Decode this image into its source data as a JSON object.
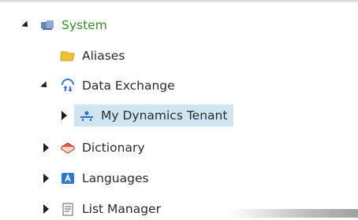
{
  "tree": {
    "nodes": [
      {
        "label": "System",
        "expanded": true,
        "icon": "system-icon"
      },
      {
        "label": "Aliases",
        "expanded": null,
        "icon": "folder-icon"
      },
      {
        "label": "Data Exchange",
        "expanded": true,
        "icon": "data-exchange-icon"
      },
      {
        "label": "My Dynamics Tenant",
        "expanded": false,
        "icon": "tenant-icon",
        "selected": true
      },
      {
        "label": "Dictionary",
        "expanded": false,
        "icon": "dictionary-icon"
      },
      {
        "label": "Languages",
        "expanded": false,
        "icon": "languages-icon"
      },
      {
        "label": "List Manager",
        "expanded": false,
        "icon": "list-manager-icon"
      }
    ]
  },
  "colors": {
    "selection": "#cfe6f2",
    "system_label": "#3a8a2e"
  }
}
